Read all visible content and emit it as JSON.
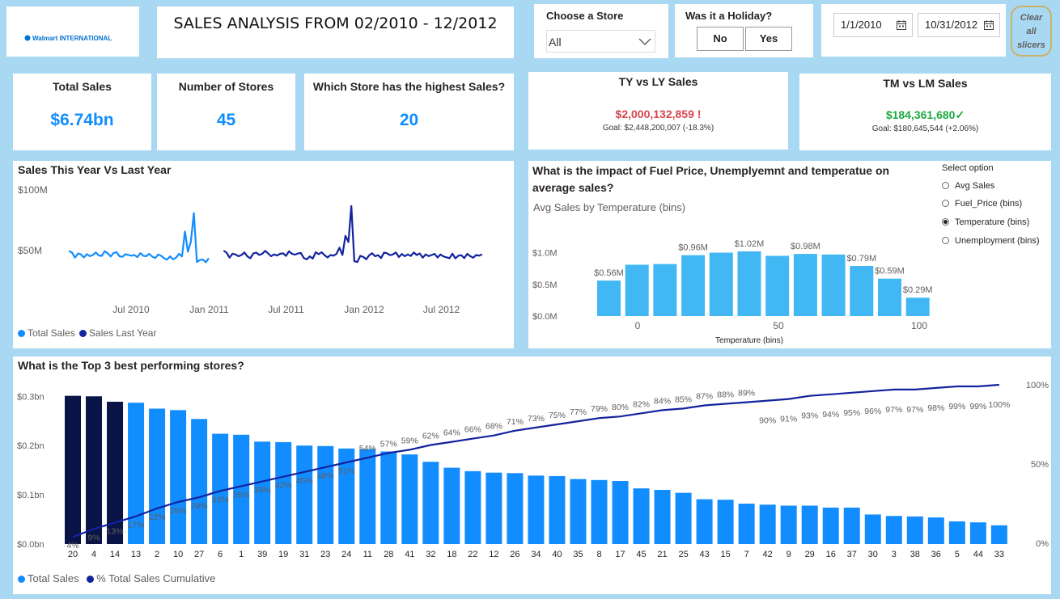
{
  "header": {
    "logo_text": "Walmart INTERNATIONAL",
    "title": "SALES ANALYSIS FROM 02/2010 - 12/2012"
  },
  "store_slicer": {
    "label": "Choose a Store",
    "value": "All"
  },
  "holiday_slicer": {
    "label": "Was it a Holiday?",
    "no": "No",
    "yes": "Yes"
  },
  "date_slicer": {
    "start": "1/1/2010",
    "end": "10/31/2012"
  },
  "clear_button": {
    "line1": "Clear",
    "line2": "all",
    "line3": "slicers"
  },
  "kpis": {
    "total_sales": {
      "label": "Total Sales",
      "value": "$6.74bn"
    },
    "num_stores": {
      "label": "Number of Stores",
      "value": "45"
    },
    "highest_store": {
      "label": "Which Store has the highest Sales?",
      "value": "20"
    },
    "ty_ly": {
      "label": "TY vs LY Sales",
      "value": "$2,000,132,859",
      "flag": "!",
      "goal": "Goal: $2,448,200,007 (-18.3%)"
    },
    "tm_lm": {
      "label": "TM vs LM Sales",
      "value": "$184,361,680",
      "flag": "✓",
      "goal": "Goal: $180,645,544 (+2.06%)"
    }
  },
  "colors": {
    "primary": "#118dff",
    "dark": "#12239e",
    "darkest": "#0b1446",
    "temp_bar": "#41b8f4",
    "red": "#d64550",
    "green": "#1aab40",
    "bg": "#a9d8f3"
  },
  "ty_ly_section": {
    "title": "Sales This Year Vs Last Year"
  },
  "impact_section": {
    "title": "What is the impact of Fuel Price, Unemplyemnt and temperatue on average sales?",
    "subtitle": "Avg Sales by Temperature (bins)",
    "option_title": "Select option",
    "options": [
      "Avg Sales",
      "Fuel_Price (bins)",
      "Temperature (bins)",
      "Unemployment (bins)"
    ],
    "selected": 2
  },
  "top3_section": {
    "title": "What is the Top 3 best performing stores?"
  },
  "chart_data": [
    {
      "type": "line",
      "title": "Sales This Year Vs Last Year",
      "y_tick_labels": [
        "$50M",
        "$100M"
      ],
      "x_tick_labels": [
        "Jul 2010",
        "Jan 2011",
        "Jul 2011",
        "Jan 2012",
        "Jul 2012"
      ],
      "ylim": [
        0,
        100000000
      ],
      "series": [
        {
          "name": "Total Sales",
          "color": "#118dff",
          "start": "2010-02-05",
          "values": [
            49.8,
            48.3,
            44.2,
            47.6,
            46.9,
            44.3,
            47.1,
            45.4,
            46.3,
            48.5,
            46.0,
            45.6,
            49.5,
            47.8,
            45.1,
            48.1,
            48.7,
            45.2,
            44.9,
            47.1,
            46.4,
            45.8,
            46.3,
            44.6,
            47.9,
            45.7,
            45.4,
            47.3,
            45.0,
            43.9,
            46.8,
            45.7,
            43.7,
            42.6,
            45.2,
            42.8,
            44.2,
            47.3,
            45.2,
            65.8,
            49.1,
            57.5,
            80.9,
            40.6,
            42.2,
            42.7,
            40.4,
            43.7
          ]
        },
        {
          "name": "Sales Last Year",
          "color": "#12239e",
          "start": "2011-02-04",
          "values": [
            49.9,
            48.3,
            44.2,
            47.4,
            46.9,
            45.3,
            46.3,
            48.5,
            45.2,
            43.7,
            47.6,
            48.3,
            46.4,
            47.3,
            49.8,
            47.6,
            45.3,
            46.9,
            45.9,
            47.3,
            47.8,
            45.6,
            49.4,
            47.4,
            46.7,
            47.6,
            48.1,
            43.9,
            42.8,
            45.2,
            43.4,
            48.7,
            47.1,
            48.7,
            46.1,
            44.3,
            46.4,
            45.8,
            47.3,
            52.4,
            46.3,
            62.2,
            57.1,
            86.8,
            41.2,
            40.6,
            45.7,
            44.8,
            42.9,
            46.1,
            47.8,
            45.3,
            46.2,
            43.9,
            48.3,
            47.8,
            46.2,
            46.9,
            48.5,
            44.7,
            47.2,
            45.3,
            46.9,
            45.6,
            48.5,
            46.3,
            47.7,
            44.2,
            46.9,
            45.5,
            46.3,
            47.3,
            44.3,
            46.8,
            45.1,
            44.5,
            43.7,
            47.5,
            43.6,
            45.8,
            46.2,
            43.8,
            47.3,
            45.4,
            44.1,
            46.3,
            45.8,
            47.0
          ]
        }
      ],
      "legend": "bottom-left",
      "grid": false
    },
    {
      "type": "bar",
      "title": "Avg Sales by Temperature (bins)",
      "xlabel": "Temperature (bins)",
      "x_tick_labels": [
        "0",
        "50",
        "100"
      ],
      "y_tick_labels": [
        "$0.0M",
        "$0.5M",
        "$1.0M"
      ],
      "ylim": [
        0,
        1.3
      ],
      "values": [
        0.56,
        0.81,
        0.82,
        0.96,
        1.0,
        1.02,
        0.95,
        0.98,
        0.97,
        0.79,
        0.59,
        0.29
      ],
      "data_labels": [
        "$0.56M",
        "",
        "",
        "$0.96M",
        "",
        "$1.02M",
        "",
        "$0.98M",
        "",
        "$0.79M",
        "$0.59M",
        "$0.29M"
      ]
    },
    {
      "type": "bar",
      "title": "What is the Top 3 best performing stores?",
      "categories": [
        "20",
        "4",
        "14",
        "13",
        "2",
        "10",
        "27",
        "6",
        "1",
        "39",
        "19",
        "31",
        "23",
        "24",
        "11",
        "28",
        "41",
        "32",
        "18",
        "22",
        "12",
        "26",
        "34",
        "40",
        "35",
        "8",
        "17",
        "45",
        "21",
        "25",
        "43",
        "15",
        "7",
        "42",
        "9",
        "29",
        "16",
        "37",
        "30",
        "3",
        "38",
        "36",
        "5",
        "44",
        "33"
      ],
      "y_tick_labels": [
        "$0.0bn",
        "$0.1bn",
        "$0.2bn",
        "$0.3bn"
      ],
      "y2_tick_labels": [
        "0%",
        "50%",
        "100%"
      ],
      "ylim": [
        0,
        0.33
      ],
      "series": [
        {
          "name": "Total Sales",
          "color": "#118dff",
          "values": [
            0.301,
            0.3,
            0.289,
            0.287,
            0.275,
            0.272,
            0.254,
            0.224,
            0.222,
            0.208,
            0.207,
            0.2,
            0.199,
            0.194,
            0.193,
            0.188,
            0.182,
            0.167,
            0.155,
            0.148,
            0.145,
            0.144,
            0.139,
            0.138,
            0.132,
            0.13,
            0.128,
            0.113,
            0.11,
            0.104,
            0.091,
            0.09,
            0.082,
            0.08,
            0.078,
            0.078,
            0.074,
            0.074,
            0.06,
            0.057,
            0.056,
            0.054,
            0.046,
            0.044,
            0.038
          ]
        },
        {
          "name": "% Total Sales Cumulative",
          "color": "#12239e",
          "values": [
            4,
            9,
            13,
            17,
            22,
            26,
            29,
            33,
            36,
            39,
            42,
            45,
            48,
            51,
            54,
            57,
            59,
            62,
            64,
            66,
            68,
            71,
            73,
            75,
            77,
            79,
            80,
            82,
            84,
            85,
            87,
            88,
            89,
            90,
            91,
            93,
            94,
            95,
            96,
            97,
            97,
            98,
            99,
            99,
            100
          ]
        }
      ],
      "highlight_top": 3,
      "legend": "bottom-left"
    }
  ]
}
